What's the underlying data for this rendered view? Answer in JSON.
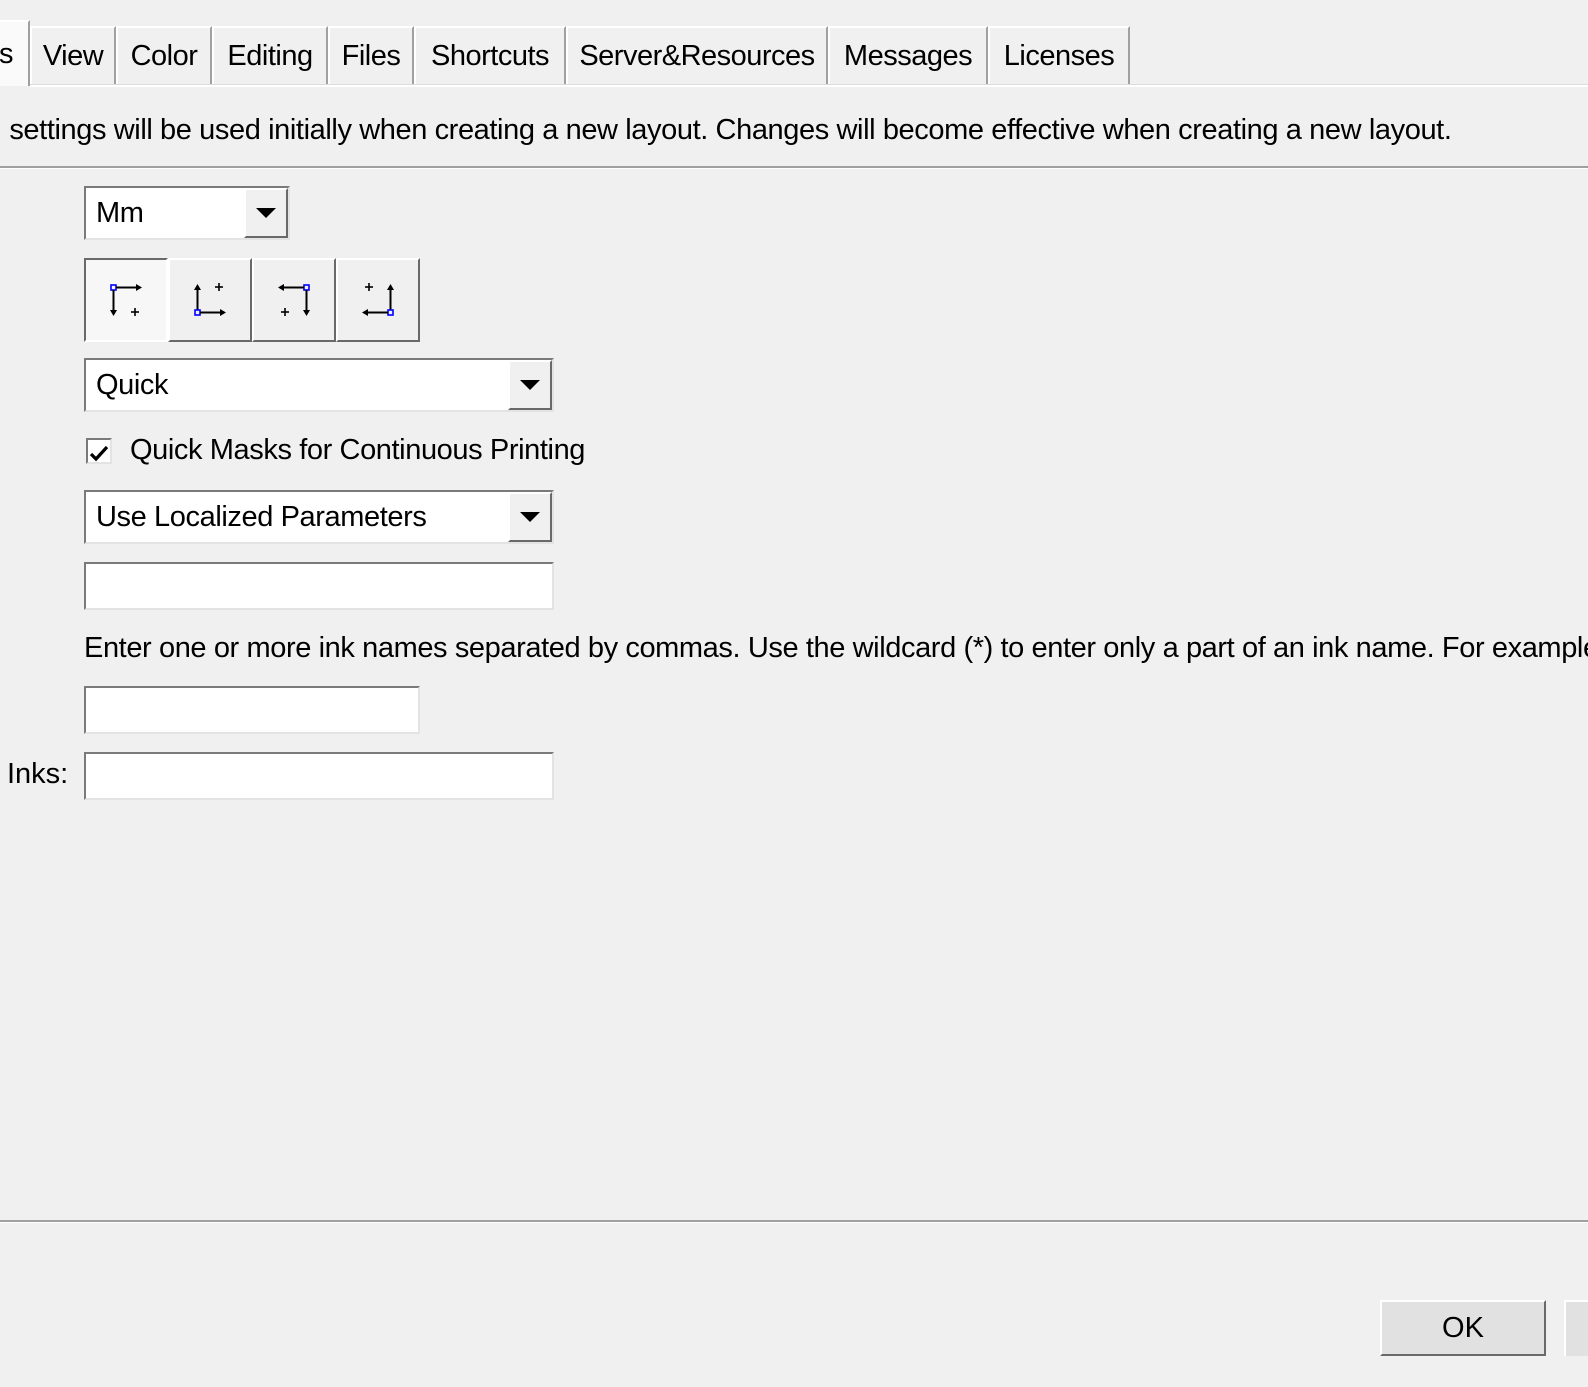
{
  "tabs": [
    {
      "label": "s"
    },
    {
      "label": "View"
    },
    {
      "label": "Color"
    },
    {
      "label": "Editing"
    },
    {
      "label": "Files"
    },
    {
      "label": "Shortcuts"
    },
    {
      "label": "Server&Resources"
    },
    {
      "label": "Messages"
    },
    {
      "label": "Licenses"
    }
  ],
  "description": "settings will be used initially when creating a new layout. Changes will become effective when creating a new layout.",
  "unit_combo": {
    "value": "Mm"
  },
  "origin_buttons": [
    {
      "icon": "origin-top-left-icon",
      "pressed": true
    },
    {
      "icon": "origin-bottom-left-icon",
      "pressed": false
    },
    {
      "icon": "origin-top-right-icon",
      "pressed": false
    },
    {
      "icon": "origin-bottom-right-icon",
      "pressed": false
    }
  ],
  "mode_combo": {
    "value": "Quick"
  },
  "quick_masks_checkbox": {
    "label": "Quick Masks for Continuous Printing",
    "checked": true
  },
  "params_combo": {
    "value": "Use Localized Parameters"
  },
  "ink_names_field": {
    "value": ""
  },
  "ink_hint": "Enter one or more ink names separated by commas. Use the wildcard (*) to enter only a part of an ink name. For example",
  "second_field": {
    "value": ""
  },
  "inks_label": "Inks:",
  "inks_field": {
    "value": ""
  },
  "ok_button": {
    "label": "OK"
  }
}
